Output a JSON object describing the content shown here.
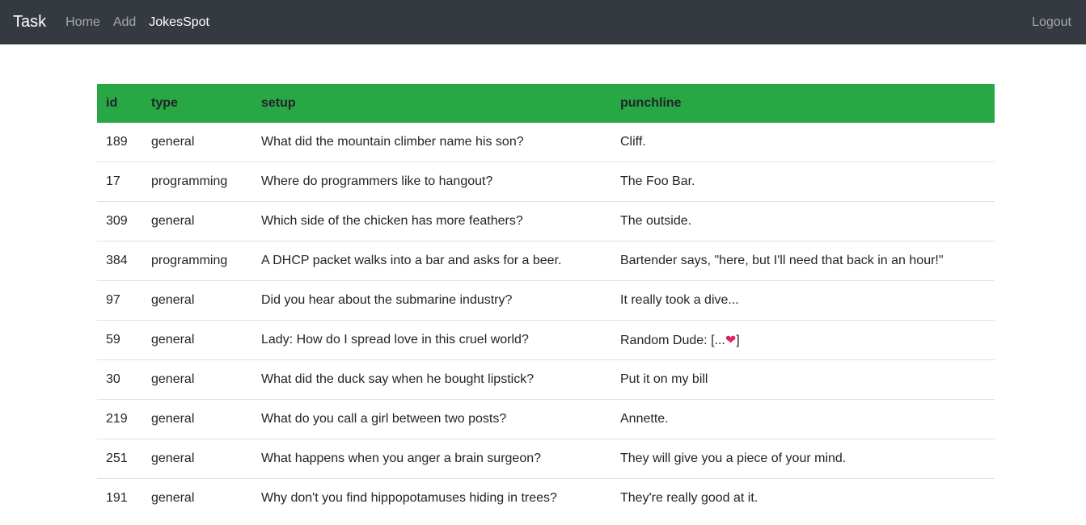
{
  "navbar": {
    "brand": "Task",
    "links": [
      {
        "label": "Home"
      },
      {
        "label": "Add"
      },
      {
        "label": "JokesSpot"
      }
    ],
    "logout": "Logout"
  },
  "table": {
    "headers": {
      "id": "id",
      "type": "type",
      "setup": "setup",
      "punchline": "punchline"
    },
    "header_color": "#28a745",
    "rows": [
      {
        "id": "189",
        "type": "general",
        "setup": "What did the mountain climber name his son?",
        "punchline": "Cliff."
      },
      {
        "id": "17",
        "type": "programming",
        "setup": "Where do programmers like to hangout?",
        "punchline": "The Foo Bar."
      },
      {
        "id": "309",
        "type": "general",
        "setup": "Which side of the chicken has more feathers?",
        "punchline": "The outside."
      },
      {
        "id": "384",
        "type": "programming",
        "setup": "A DHCP packet walks into a bar and asks for a beer.",
        "punchline": "Bartender says, \"here, but I'll need that back in an hour!\""
      },
      {
        "id": "97",
        "type": "general",
        "setup": "Did you hear about the submarine industry?",
        "punchline": "It really took a dive..."
      },
      {
        "id": "59",
        "type": "general",
        "setup": "Lady: How do I spread love in this cruel world?",
        "punchline": "Random Dude: [...❤]"
      },
      {
        "id": "30",
        "type": "general",
        "setup": "What did the duck say when he bought lipstick?",
        "punchline": "Put it on my bill"
      },
      {
        "id": "219",
        "type": "general",
        "setup": "What do you call a girl between two posts?",
        "punchline": "Annette."
      },
      {
        "id": "251",
        "type": "general",
        "setup": "What happens when you anger a brain surgeon?",
        "punchline": "They will give you a piece of your mind."
      },
      {
        "id": "191",
        "type": "general",
        "setup": "Why don't you find hippopotamuses hiding in trees?",
        "punchline": "They're really good at it."
      }
    ]
  }
}
